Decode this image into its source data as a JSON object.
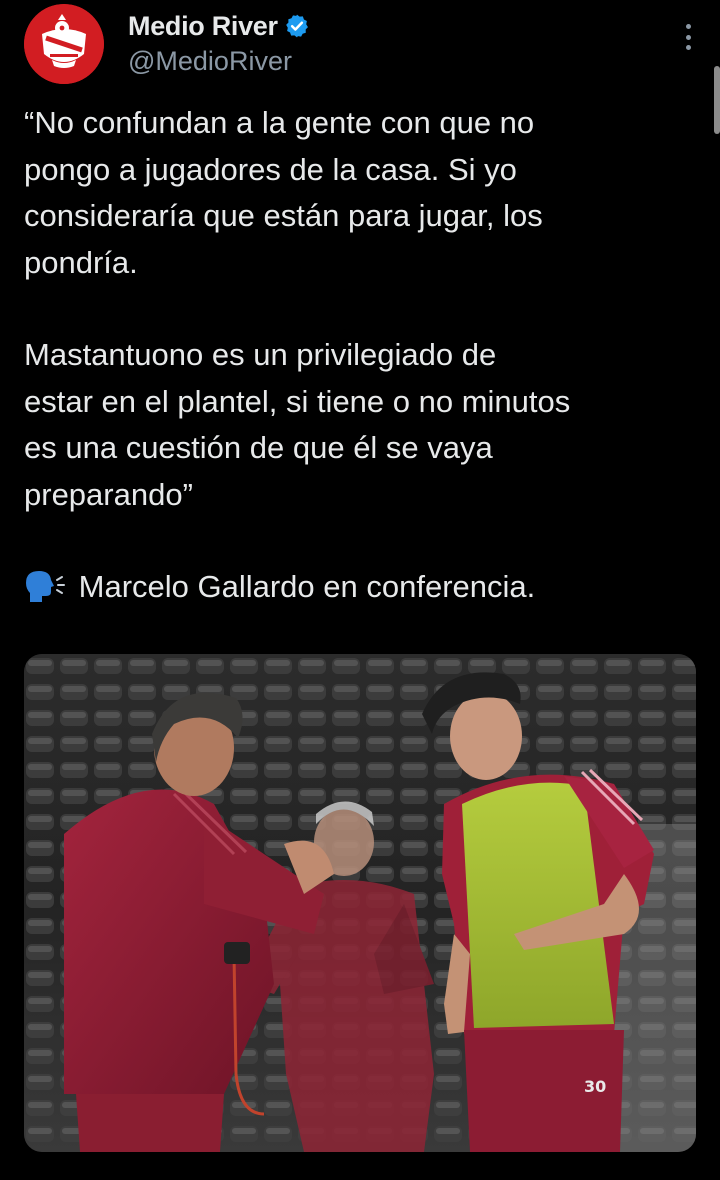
{
  "author": {
    "display_name": "Medio River",
    "handle": "@MedioRiver",
    "verified": true
  },
  "tweet": {
    "paragraph_1": [
      "“No confundan a la gente con que no",
      "pongo a jugadores de la casa. Si yo",
      "consideraría que están para jugar, los",
      "pondría."
    ],
    "paragraph_2": [
      "Mastantuono es un privilegiado de",
      "estar en el plantel, si tiene o no minutos",
      "es una cuestión de que él se vaya",
      "preparando”"
    ],
    "attribution_emoji": "speaking-head-icon",
    "attribution": "Marcelo Gallardo en conferencia."
  },
  "media": {
    "description_icon": "photo",
    "shirt_number": "30"
  },
  "colors": {
    "background": "#000000",
    "text": "#e7e9ea",
    "secondary_text": "#8b98a5",
    "verified": "#1d9bf0",
    "avatar_red": "#d21d22"
  }
}
